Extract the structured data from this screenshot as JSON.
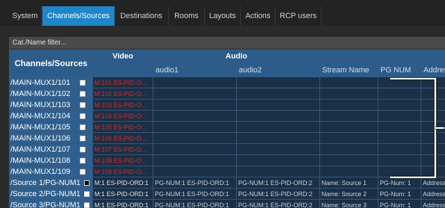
{
  "tabs": [
    {
      "label": "System",
      "active": false
    },
    {
      "label": "Channels/Sources",
      "active": true
    },
    {
      "label": "Destinations",
      "active": false
    },
    {
      "label": "Rooms",
      "active": false
    },
    {
      "label": "Layouts",
      "active": false
    },
    {
      "label": "Actions",
      "active": false
    },
    {
      "label": "RCP users",
      "active": false
    }
  ],
  "filter": {
    "placeholder": "Cat./Name filter..."
  },
  "table": {
    "channels_header": "Channels/Sources",
    "video_header": "Video",
    "audio_header": "Audio",
    "columns": {
      "audio1": "audio1",
      "audio2": "audio2",
      "stream_name": "Stream Name",
      "pg_num": "PG NUM",
      "address": "Address"
    },
    "rows": [
      {
        "name": "/MAIN-MUX1/101",
        "check": "white",
        "video": "M:101 ES-PID-O...",
        "audio1": "",
        "audio2": "",
        "stream_name": "",
        "pg_num": "",
        "address": ""
      },
      {
        "name": "/MAIN-MUX1/102",
        "check": "white",
        "video": "M:102 ES-PID-O...",
        "audio1": "",
        "audio2": "",
        "stream_name": "",
        "pg_num": "",
        "address": ""
      },
      {
        "name": "/MAIN-MUX1/103",
        "check": "white",
        "video": "M:103 ES-PID-O...",
        "audio1": "",
        "audio2": "",
        "stream_name": "",
        "pg_num": "",
        "address": ""
      },
      {
        "name": "/MAIN-MUX1/104",
        "check": "white",
        "video": "M:104 ES-PID-O...",
        "audio1": "",
        "audio2": "",
        "stream_name": "",
        "pg_num": "",
        "address": ""
      },
      {
        "name": "/MAIN-MUX1/105",
        "check": "white",
        "video": "M:105 ES-PID-O...",
        "audio1": "",
        "audio2": "",
        "stream_name": "",
        "pg_num": "",
        "address": ""
      },
      {
        "name": "/MAIN-MUX1/106",
        "check": "white",
        "video": "M:106 ES-PID-O...",
        "audio1": "",
        "audio2": "",
        "stream_name": "",
        "pg_num": "",
        "address": ""
      },
      {
        "name": "/MAIN-MUX1/107",
        "check": "white",
        "video": "M:107 ES-PID-O...",
        "audio1": "",
        "audio2": "",
        "stream_name": "",
        "pg_num": "",
        "address": ""
      },
      {
        "name": "/MAIN-MUX1/108",
        "check": "white",
        "video": "M:108 ES-PID-O...",
        "audio1": "",
        "audio2": "",
        "stream_name": "",
        "pg_num": "",
        "address": ""
      },
      {
        "name": "/MAIN-MUX1/109",
        "check": "white",
        "video": "M:109 ES-PID-O...",
        "audio1": "",
        "audio2": "",
        "stream_name": "",
        "pg_num": "",
        "address": ""
      },
      {
        "name": "/Source 1/PG-NUM1",
        "check": "dark",
        "video": "M:1 ES-PID-ORD:1",
        "audio1": "PG-NUM:1 ES-PID-ORD:1",
        "audio2": "PG-NUM:1 ES-PID-ORD:2",
        "stream_name": "Name: Source 1",
        "pg_num": "PG-Num: 1",
        "address": "Address"
      },
      {
        "name": "/Source 2/PG-NUM1",
        "check": "white",
        "video": "M:1 ES-PID-ORD:1",
        "audio1": "PG-NUM:1 ES-PID-ORD:1",
        "audio2": "PG-NUM:1 ES-PID-ORD:2",
        "stream_name": "Name: Source 2",
        "pg_num": "PG-Num: 1",
        "address": "Address"
      },
      {
        "name": "/Source 3/PG-NUM1",
        "check": "white",
        "video": "M:1 ES-PID-ORD:1",
        "audio1": "PG-NUM:1 ES-PID-ORD:1",
        "audio2": "PG-NUM:1 ES-PID-ORD:2",
        "stream_name": "Name: Source 3",
        "pg_num": "PG-Num: 1",
        "address": "Address"
      }
    ]
  },
  "colors": {
    "accent": "#1f87c9",
    "header_bg": "#2d5c8a",
    "video_error": "#d62b2b"
  }
}
